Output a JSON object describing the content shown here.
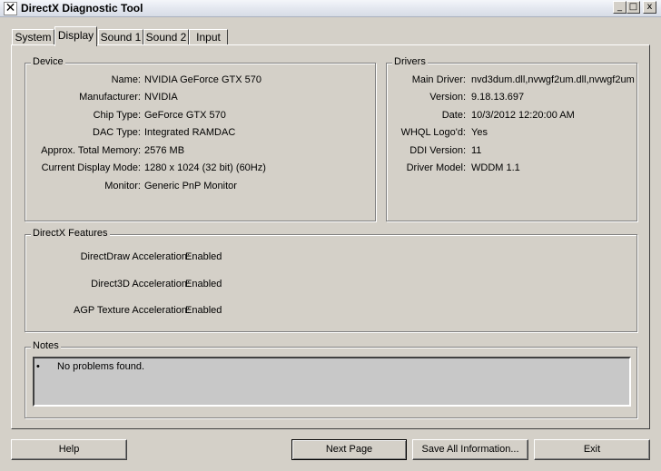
{
  "window": {
    "title": "DirectX Diagnostic Tool",
    "icon_glyph": "✕",
    "controls": {
      "minimize": "_",
      "maximize": "□",
      "close": "x"
    }
  },
  "tabs": [
    {
      "label": "System",
      "active": false
    },
    {
      "label": "Display",
      "active": true
    },
    {
      "label": "Sound 1",
      "active": false
    },
    {
      "label": "Sound 2",
      "active": false
    },
    {
      "label": "Input",
      "active": false
    }
  ],
  "device": {
    "title": "Device",
    "rows": [
      {
        "label": "Name:",
        "value": "NVIDIA GeForce GTX 570"
      },
      {
        "label": "Manufacturer:",
        "value": "NVIDIA"
      },
      {
        "label": "Chip Type:",
        "value": "GeForce GTX 570"
      },
      {
        "label": "DAC Type:",
        "value": "Integrated RAMDAC"
      },
      {
        "label": "Approx. Total Memory:",
        "value": "2576 MB"
      },
      {
        "label": "Current Display Mode:",
        "value": "1280 x 1024 (32 bit) (60Hz)"
      },
      {
        "label": "Monitor:",
        "value": "Generic PnP Monitor"
      }
    ]
  },
  "drivers": {
    "title": "Drivers",
    "rows": [
      {
        "label": "Main Driver:",
        "value": "nvd3dum.dll,nvwgf2um.dll,nvwgf2um"
      },
      {
        "label": "Version:",
        "value": "9.18.13.697"
      },
      {
        "label": "Date:",
        "value": "10/3/2012 12:20:00 AM"
      },
      {
        "label": "WHQL Logo'd:",
        "value": "Yes"
      },
      {
        "label": "DDI Version:",
        "value": "11"
      },
      {
        "label": "Driver Model:",
        "value": "WDDM 1.1"
      }
    ]
  },
  "features": {
    "title": "DirectX Features",
    "rows": [
      {
        "label": "DirectDraw Acceleration:",
        "value": "Enabled"
      },
      {
        "label": "Direct3D Acceleration:",
        "value": "Enabled"
      },
      {
        "label": "AGP Texture Acceleration:",
        "value": "Enabled"
      }
    ]
  },
  "notes": {
    "title": "Notes",
    "bullet": "•",
    "items": [
      "No problems found."
    ]
  },
  "buttons": {
    "help": "Help",
    "next_page": "Next Page",
    "save_all": "Save All Information...",
    "exit": "Exit"
  }
}
